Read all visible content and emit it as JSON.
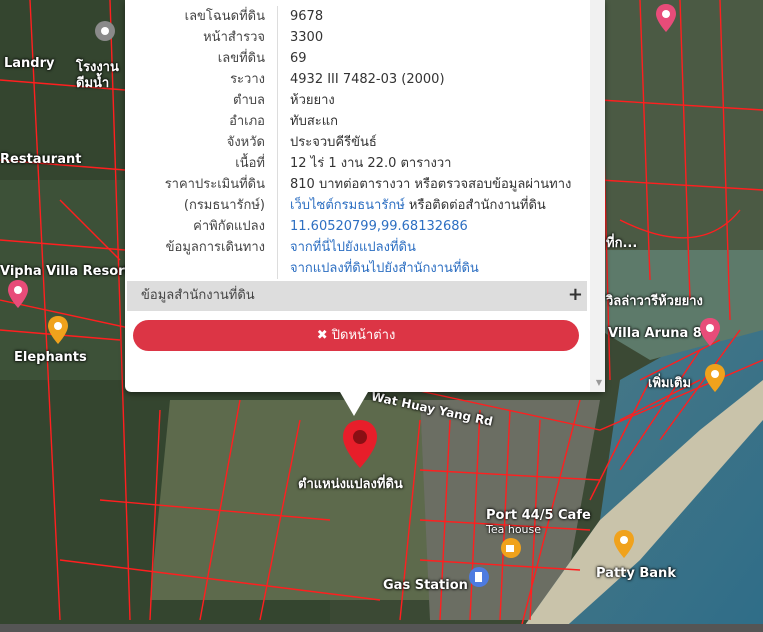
{
  "parcel": {
    "rows": [
      {
        "key": "เลขโฉนดที่ดิน",
        "value": "9678"
      },
      {
        "key": "หน้าสำรวจ",
        "value": "3300"
      },
      {
        "key": "เลขที่ดิน",
        "value": "69"
      },
      {
        "key": "ระวาง",
        "value": "4932 III 7482-03 (2000)"
      },
      {
        "key": "ตำบล",
        "value": "ห้วยยาง"
      },
      {
        "key": "อำเภอ",
        "value": "ทับสะแก"
      },
      {
        "key": "จังหวัด",
        "value": "ประจวบคีรีขันธ์"
      },
      {
        "key": "เนื้อที่",
        "value": "12 ไร่ 1 งาน 22.0 ตารางวา"
      },
      {
        "key": "ราคาประเมินที่ดิน",
        "value": "810 บาทต่อตารางวา หรือตรวจสอบข้อมูลผ่านทาง"
      }
    ],
    "price_ref": {
      "key": "(กรมธนารักษ์)",
      "link": "เว็บไซต์กรมธนารักษ์",
      "suffix": " หรือติดต่อสำนักงานที่ดิน"
    },
    "coords": {
      "key": "ค่าพิกัดแปลง",
      "value": "11.60520799,99.68132686"
    },
    "route": {
      "key": "ข้อมูลการเดินทาง",
      "link1": "จากที่นี่ไปยังแปลงที่ดิน",
      "link2": "จากแปลงที่ดินไปยังสำนักงานที่ดิน"
    },
    "office_label": "ข้อมูลสำนักงานที่ดิน",
    "office_toggle": "+",
    "close_label": "ปิดหน้าต่าง",
    "close_icon": "✖"
  },
  "map": {
    "pin_label": "ตำแหน่งแปลงที่ดิน",
    "labels": {
      "restaurant": "Restaurant",
      "vipha": "Vipha Villa Resort",
      "elephants": "Elephants",
      "landry": "Landry",
      "wat": "Wat Huay Yang Rd",
      "port": "Port 44/5 Cafe",
      "teahouse": "Tea house",
      "gas": "Gas Station",
      "patty": "Patty Bank",
      "aruna": "Villa Aruna 8",
      "wilat": "วิลล่าวารีห้วยยาง",
      "phoen": "เพิ่มเติม",
      "rongngan": "โรงงาน",
      "rongngan2": "ดีมน้ำ",
      "thai_frag": "ที่ก..."
    }
  },
  "colors": {
    "accent_red": "#dc3545",
    "link_blue": "#2d6fc2",
    "parcel_line": "#ff1f1f"
  }
}
